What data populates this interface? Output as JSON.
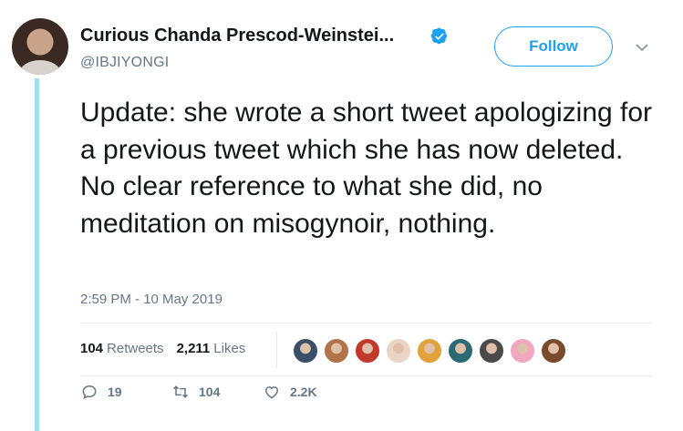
{
  "author": {
    "display_name": "Curious Chanda Prescod-Weinstei...",
    "handle": "@IBJIYONGI",
    "verified_icon": "verified-badge-icon",
    "avatar": "avatar"
  },
  "follow_label": "Follow",
  "tweet": {
    "text": "Update: she wrote a short tweet apologizing for a previous tweet which she has now deleted. No clear reference to what she did, no meditation on misogynoir, nothing.",
    "timestamp": "2:59 PM - 10 May 2019"
  },
  "stats": {
    "retweets_count": "104",
    "retweets_label": "Retweets",
    "likes_count": "2,211",
    "likes_label": "Likes"
  },
  "liker_avatars": [
    {
      "color": "#3b4f6b"
    },
    {
      "color": "#b0734a"
    },
    {
      "color": "#c0392b"
    },
    {
      "color": "#e8d5c4"
    },
    {
      "color": "#e2a23b"
    },
    {
      "color": "#2a6b73"
    },
    {
      "color": "#4a4a4a"
    },
    {
      "color": "#f2a7c0"
    },
    {
      "color": "#7a4a2e"
    }
  ],
  "actions": {
    "reply_count": "19",
    "retweet_count": "104",
    "like_count": "2.2K"
  },
  "colors": {
    "accent": "#1da1f2",
    "secondary_text": "#657786",
    "thread_line": "#a8dbef"
  }
}
